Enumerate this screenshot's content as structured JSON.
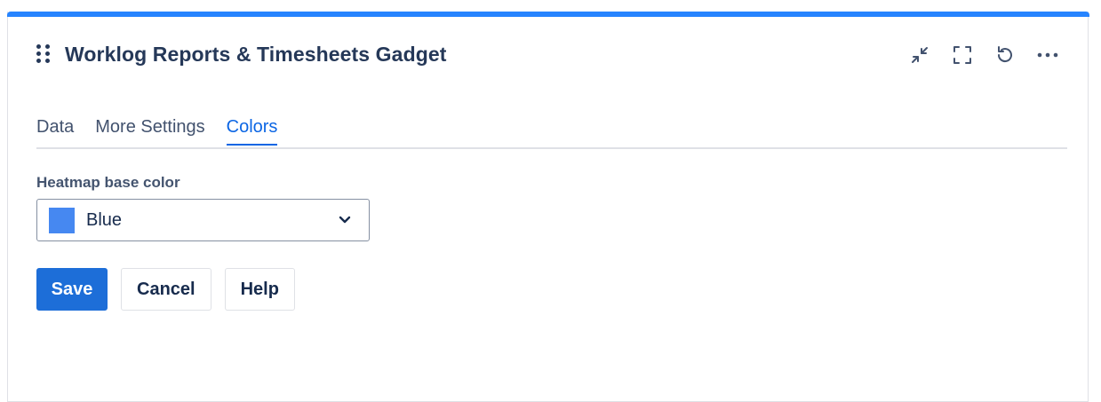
{
  "gadget": {
    "title": "Worklog Reports & Timesheets Gadget",
    "accent_color": "#2684ff",
    "header_icons": [
      "drag-handle-icon",
      "collapse-icon",
      "fullscreen-icon",
      "refresh-icon",
      "more-icon"
    ]
  },
  "tabs": [
    {
      "label": "Data",
      "active": false
    },
    {
      "label": "More Settings",
      "active": false
    },
    {
      "label": "Colors",
      "active": true
    }
  ],
  "form": {
    "heatmap_label": "Heatmap base color",
    "heatmap_value": "Blue",
    "heatmap_swatch_color": "#4688f1"
  },
  "actions": {
    "save_label": "Save",
    "cancel_label": "Cancel",
    "help_label": "Help"
  }
}
